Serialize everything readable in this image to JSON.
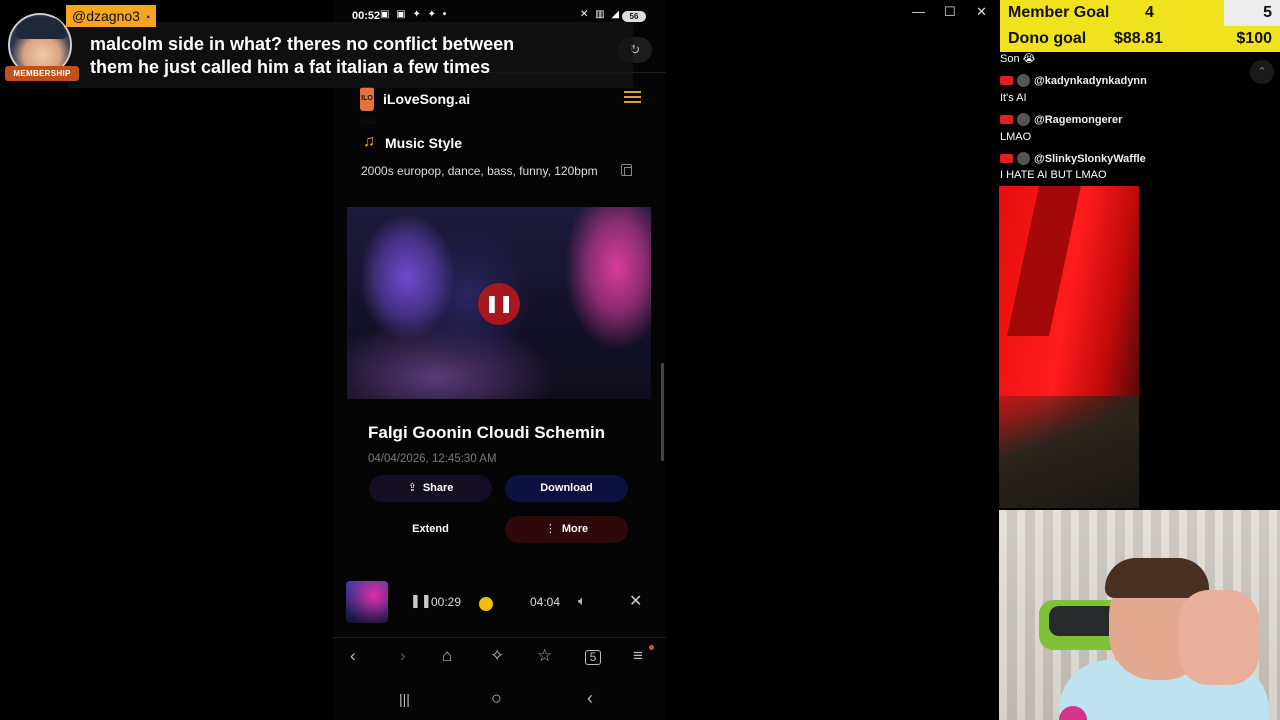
{
  "window_controls": {
    "minimize": "—",
    "maximize": "☐",
    "close": "✕"
  },
  "phone": {
    "status_time": "00:52",
    "status_icons": "▣ ▣ ✦ ✦ •",
    "status_right": "✕ ▥ ◢",
    "battery": "56",
    "brand_logo_text": "ILO SNG",
    "brand_name": "iLoveSong.ai",
    "music_style_title": "Music Style",
    "music_style_tags": "2000s europop, dance, bass, funny, 120bpm",
    "song_title": "Falgi Goonin Cloudi Schemin",
    "song_date": "04/04/2026, 12:45:30 AM",
    "buttons": {
      "share": "Share",
      "download": "Download",
      "extend": "Extend",
      "more": "More"
    },
    "mini_player": {
      "current_time": "00:29",
      "duration": "04:04"
    },
    "browser_nav": {
      "back": "‹",
      "forward": "›",
      "home": "⌂",
      "ai": "✧",
      "bookmark": "☆",
      "tabs": "5",
      "menu": "≡"
    },
    "system_nav": {
      "recents": "|||",
      "home": "○",
      "back": "‹"
    }
  },
  "chat_overlay": {
    "username": "@dzagno3",
    "badge": "MEMBERSHIP",
    "message_line1": "malcolm side in what? theres no conflict between",
    "message_line2": "them he just called him a fat italian a few times"
  },
  "goals": {
    "member": {
      "label": "Member Goal",
      "current": "4",
      "target": "5"
    },
    "dono": {
      "label": "Dono goal",
      "current": "$88.81",
      "target": "$100"
    }
  },
  "chat": [
    {
      "type": "text",
      "text": "Son 😭"
    },
    {
      "type": "user",
      "user": "@kadynkadynkadynn"
    },
    {
      "type": "text",
      "text": "It's AI"
    },
    {
      "type": "user",
      "user": "@Ragemongerer"
    },
    {
      "type": "text",
      "text": "LMAO"
    },
    {
      "type": "user",
      "user": "@SlinkySlonkyWaffle"
    },
    {
      "type": "text",
      "text": "I HATE AI BUT LMAO"
    }
  ],
  "colors": {
    "accent_orange": "#e0a030",
    "pause_red": "#be1919",
    "goal_yellow": "#f0e21c",
    "username_bg": "#f5a51f"
  }
}
